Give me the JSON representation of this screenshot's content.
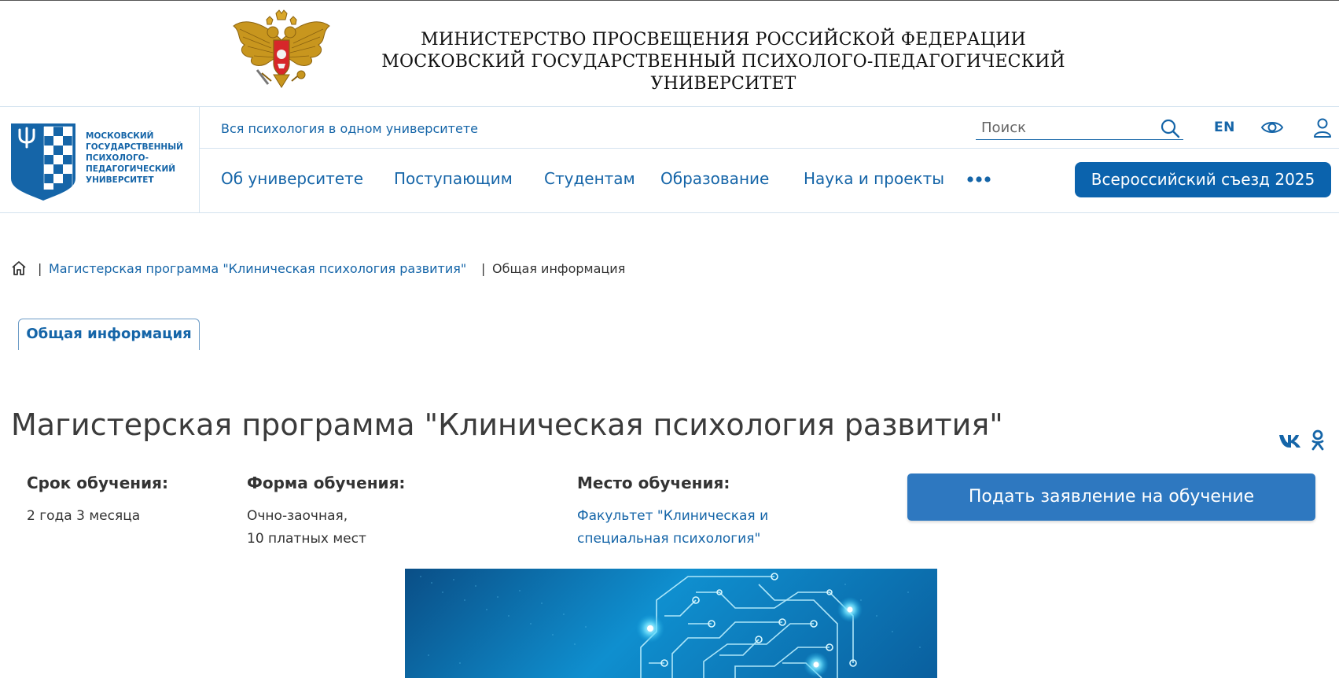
{
  "ministry": {
    "line1": "МИНИСТЕРСТВО ПРОСВЕЩЕНИЯ РОССИЙСКОЙ ФЕДЕРАЦИИ",
    "line2": "МОСКОВСКИЙ ГОСУДАРСТВЕННЫЙ ПСИХОЛОГО-ПЕДАГОГИЧЕСКИЙ УНИВЕРСИТЕТ",
    "emblem_icon": "double-headed-eagle-emblem"
  },
  "logo": {
    "line1": "МОСКОВСКИЙ",
    "line2": "ГОСУДАРСТВЕННЫЙ",
    "line3": "ПСИХОЛОГО-",
    "line4": "ПЕДАГОГИЧЕСКИЙ",
    "line5": "УНИВЕРСИТЕТ",
    "icon": "psi-shield-logo"
  },
  "topbar": {
    "tagline": "Вся психология в одном университете",
    "search_placeholder": "Поиск",
    "lang": "EN"
  },
  "nav": {
    "items": [
      {
        "label": "Об университете"
      },
      {
        "label": "Поступающим"
      },
      {
        "label": "Студентам"
      },
      {
        "label": "Образование"
      },
      {
        "label": "Наука и проекты"
      }
    ],
    "cta": "Всероссийский съезд 2025"
  },
  "breadcrumb": {
    "sep": "|",
    "link": "Магистерская программа \"Клиническая психология развития\"",
    "current": "Общая информация"
  },
  "tabs": {
    "active": "Общая информация"
  },
  "page": {
    "title": "Магистерская программа \"Клиническая психология развития\""
  },
  "info": {
    "duration_label": "Срок обучения:",
    "duration_value": "2 года 3 месяца",
    "form_label": "Форма обучения:",
    "form_value_1": "Очно-заочная,",
    "form_value_2": "10 платных мест",
    "place_label": "Место обучения:",
    "place_link_1": "Факультет \"Клиническая и",
    "place_link_2": "специальная психология\"",
    "apply_button": "Подать заявление на обучение"
  },
  "colors": {
    "brand_blue": "#1565a8",
    "button_blue": "#0b63ad",
    "apply_blue": "#2e78c0"
  }
}
